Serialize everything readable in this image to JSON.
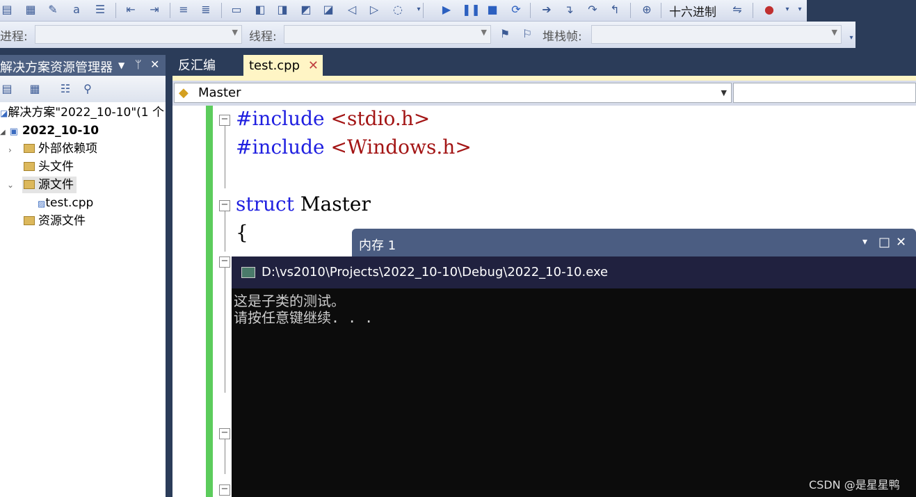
{
  "toolbar": {
    "hex_label": "十六进制",
    "process_label": "进程:",
    "thread_label": "线程:",
    "stackframe_label": "堆栈帧:"
  },
  "solution_explorer": {
    "title": "解决方案资源管理器",
    "pin": "ᛘ",
    "close": "✕",
    "dropdown": "▼",
    "solution": "解决方案\"2022_10-10\"(1 个",
    "project": "2022_10-10",
    "items": [
      {
        "label": "外部依赖项"
      },
      {
        "label": "头文件"
      },
      {
        "label": "源文件"
      },
      {
        "label": "test.cpp"
      },
      {
        "label": "资源文件"
      }
    ]
  },
  "editor": {
    "tabs": [
      {
        "label": "反汇编"
      },
      {
        "label": "test.cpp",
        "close": "✕"
      }
    ],
    "nav_combo": "Master",
    "code": [
      {
        "kw": "#include",
        "rest": " <stdio.h>"
      },
      {
        "kw": "#include",
        "rest": " <Windows.h>"
      },
      {
        "kw": "struct",
        "rest": " Master"
      },
      {
        "kw": "",
        "rest": "{"
      }
    ]
  },
  "memory_window": {
    "title": "内存 1",
    "controls": [
      "▾",
      "□",
      "✕"
    ]
  },
  "console": {
    "title": "D:\\vs2010\\Projects\\2022_10-10\\Debug\\2022_10-10.exe",
    "lines": [
      "这是子类的测试。",
      "请按任意键继续. . ."
    ]
  },
  "watermark": "CSDN @是星星鸭",
  "colors": {
    "ide_dark": "#2b3c59",
    "tab_active": "#fff5c5",
    "keyword": "#1f1fe0",
    "string": "#a31515",
    "console_bg": "#0c0c0c",
    "console_title": "#20213f"
  }
}
